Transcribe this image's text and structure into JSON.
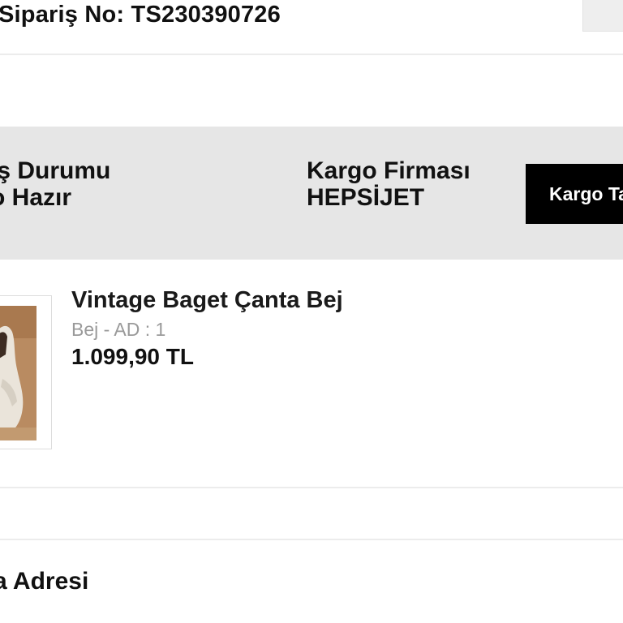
{
  "order": {
    "number_label": "Sipariş No: TS230390726"
  },
  "status": {
    "state_label": "iş Durumu",
    "state_value": "o Hazır",
    "carrier_label": "Kargo Firması",
    "carrier_value": "HEPSİJET",
    "track_button_label": "Kargo Takip"
  },
  "product": {
    "name": "Vintage Baget Çanta Bej",
    "variant": "Bej - AD : 1",
    "price": "1.099,90 TL",
    "thumbnail_icon": "product-photo"
  },
  "address": {
    "title": "a Adresi"
  },
  "colors": {
    "band_background": "#e6e6e6",
    "button_background": "#000000",
    "button_text": "#ffffff",
    "muted_text": "#9a9a9a"
  }
}
